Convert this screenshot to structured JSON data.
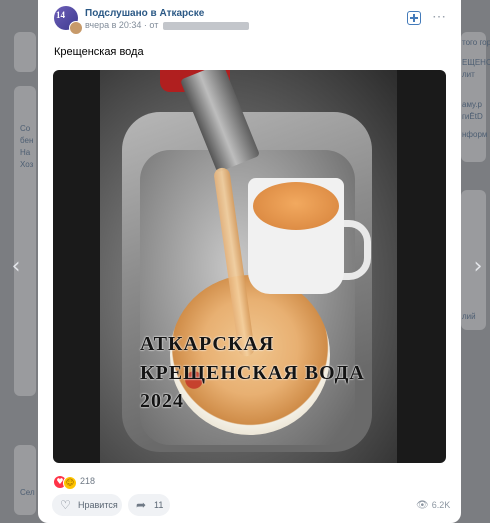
{
  "post": {
    "group_name": "Подслушано в Аткарске",
    "avatar_text": "14",
    "time": "вчера в 20:34",
    "from_prefix": "от",
    "text": "Крещенская вода",
    "overlay_lines": [
      "АТКАРСКАЯ",
      "КРЕЩЕНСКАЯ ВОДА",
      "2024"
    ],
    "reactions_count": "218",
    "like_label": "Нравится",
    "share_count": "11",
    "views": "6.2K"
  },
  "background": {
    "left_snippets": [
      "Со",
      "бен",
      "На",
      "Хоз",
      "Сел"
    ],
    "right_snippets": [
      "того горо",
      "ЕЩЕНСК",
      "лит",
      "аму.р",
      "гиЁtD",
      "нформ",
      "лий"
    ]
  },
  "icons": {
    "subscribe": "plus-square-icon",
    "more": "more-dots-icon",
    "like": "heart-icon",
    "share": "share-arrow-icon",
    "views": "eye-icon",
    "prev": "chevron-left-icon",
    "next": "chevron-right-icon"
  },
  "colors": {
    "link": "#2a5885",
    "accent": "#447bba",
    "overlay_dim": "#7b7d81"
  }
}
